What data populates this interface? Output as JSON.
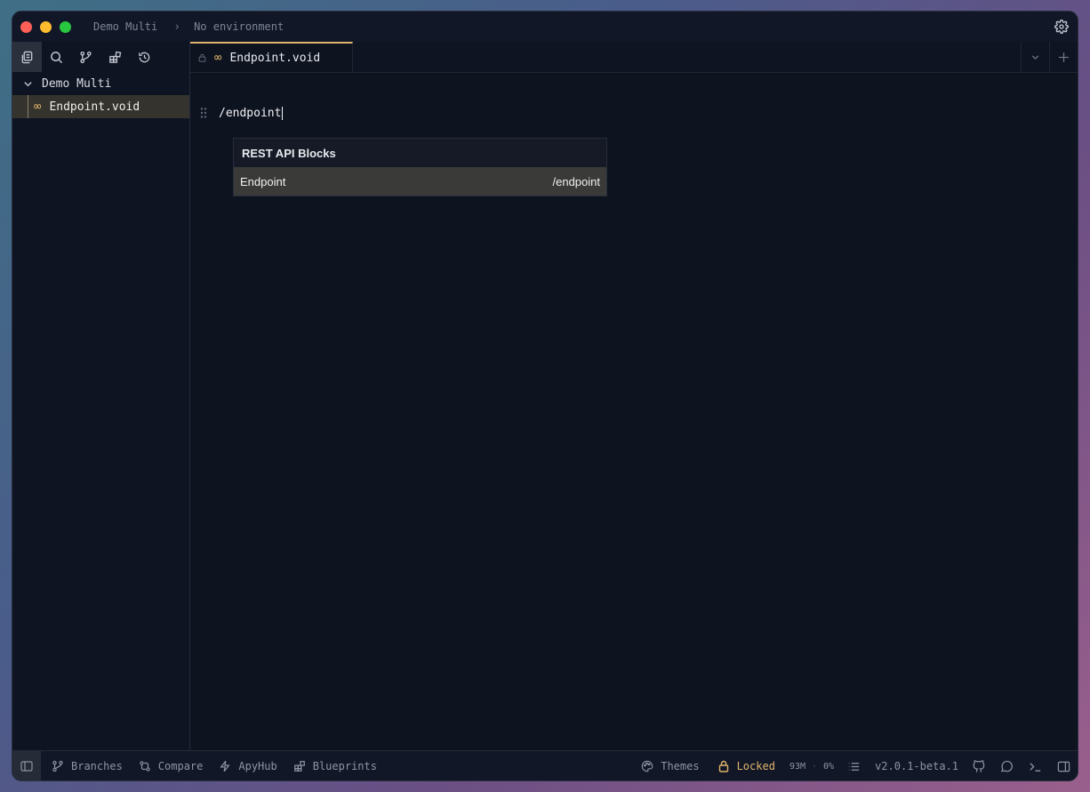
{
  "titlebar": {
    "project": "Demo Multi",
    "environment": "No environment"
  },
  "sidebar": {
    "tools": [
      "files-icon",
      "search-icon",
      "branch-icon",
      "blocks-icon",
      "history-icon"
    ],
    "root": "Demo Multi",
    "items": [
      {
        "label": "Endpoint.void",
        "icon": "infinity-icon"
      }
    ]
  },
  "tabs": [
    {
      "label": "Endpoint.void",
      "locked": true
    }
  ],
  "editor": {
    "command": "/endpoint"
  },
  "suggestion": {
    "group": "REST API Blocks",
    "items": [
      {
        "label": "Endpoint",
        "shortcut": "/endpoint"
      }
    ]
  },
  "statusbar": {
    "branches": "Branches",
    "compare": "Compare",
    "apyhub": "ApyHub",
    "blueprints": "Blueprints",
    "themes": "Themes",
    "locked": "Locked",
    "memory": "93M",
    "cpu": "0%",
    "version": "v2.0.1-beta.1"
  },
  "colors": {
    "accent": "#e0b46a",
    "background": "#0e1320",
    "selected_row": "#3a3a39"
  }
}
